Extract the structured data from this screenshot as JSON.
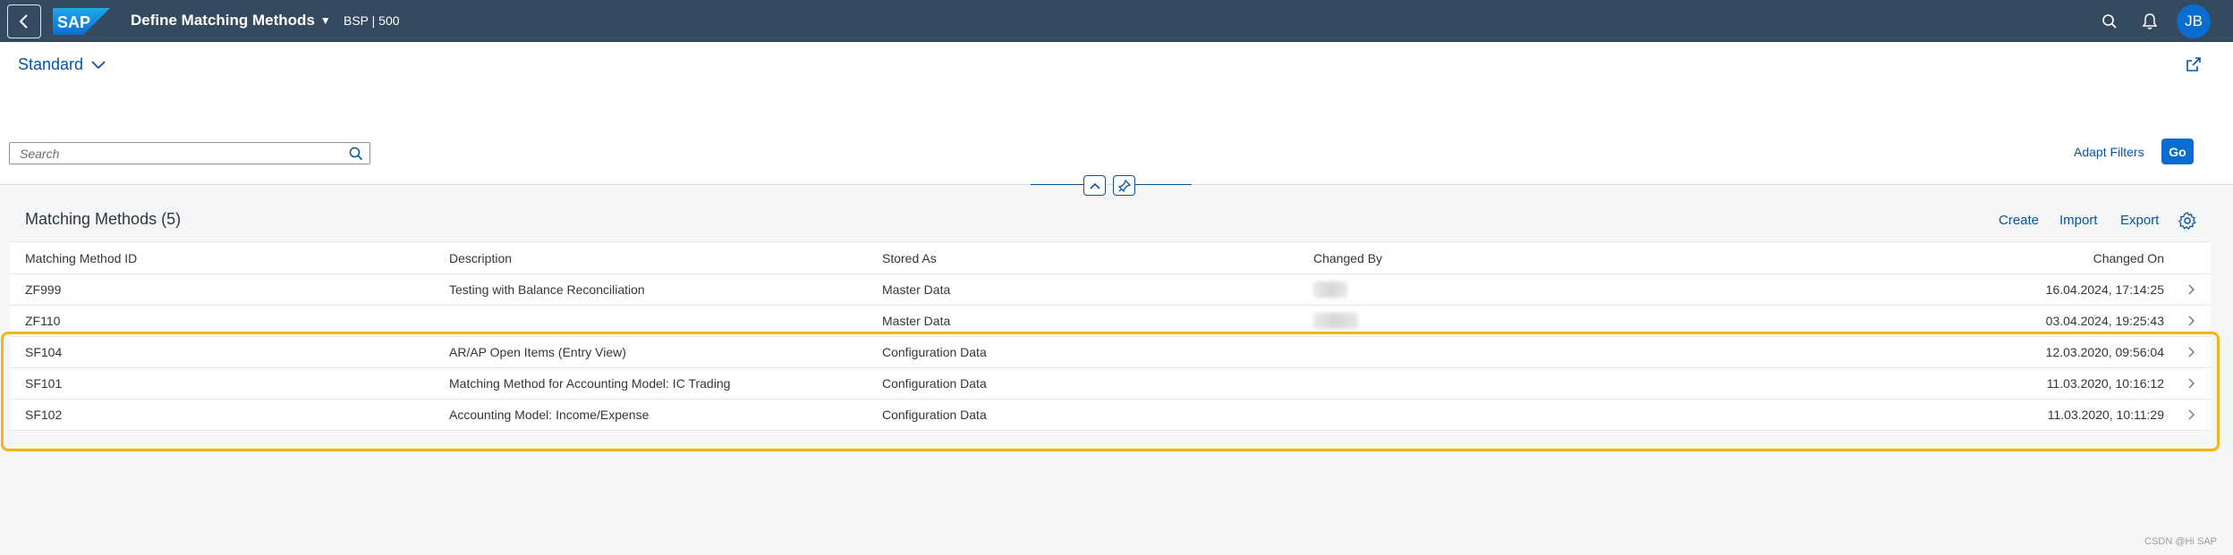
{
  "shell": {
    "app_title": "Define Matching Methods",
    "system_info": "BSP | 500",
    "user_initials": "JB",
    "logo_text": "SAP",
    "colors": {
      "shell_bg": "#354a5f",
      "accent": "#0a6ed1",
      "link": "#0854a0",
      "highlight": "#f6b40e"
    }
  },
  "header": {
    "variant_label": "Standard",
    "search_placeholder": "Search",
    "adapt_filters_label": "Adapt Filters",
    "go_label": "Go"
  },
  "table": {
    "title": "Matching Methods (5)",
    "toolbar": {
      "create_label": "Create",
      "import_label": "Import",
      "export_label": "Export"
    },
    "columns": [
      "Matching Method ID",
      "Description",
      "Stored As",
      "Changed By",
      "Changed On"
    ],
    "rows": [
      {
        "id": "ZF999",
        "description": "Testing with Balance Reconciliation",
        "stored_as": "Master Data",
        "changed_by": "",
        "changed_on": "16.04.2024, 17:14:25"
      },
      {
        "id": "ZF110",
        "description": "",
        "stored_as": "Master Data",
        "changed_by": "",
        "changed_on": "03.04.2024, 19:25:43"
      },
      {
        "id": "SF104",
        "description": "AR/AP Open Items (Entry View)",
        "stored_as": "Configuration Data",
        "changed_by": "",
        "changed_on": "12.03.2020, 09:56:04"
      },
      {
        "id": "SF101",
        "description": "Matching Method for Accounting Model: IC Trading",
        "stored_as": "Configuration Data",
        "changed_by": "",
        "changed_on": "11.03.2020, 10:16:12"
      },
      {
        "id": "SF102",
        "description": "Accounting Model: Income/Expense",
        "stored_as": "Configuration Data",
        "changed_by": "",
        "changed_on": "11.03.2020, 10:11:29"
      }
    ]
  },
  "watermark": "CSDN @Hi SAP"
}
